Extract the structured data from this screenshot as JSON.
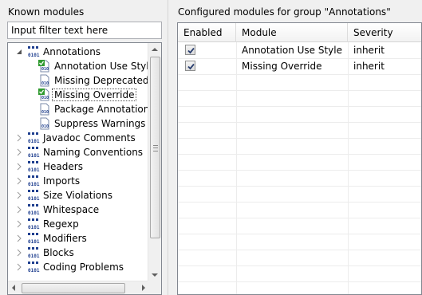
{
  "left": {
    "title": "Known modules",
    "filter_placeholder": "Input filter text here",
    "tree": [
      {
        "label": "Annotations",
        "level": 0,
        "expanded": true,
        "icon": "module-group-icon"
      },
      {
        "label": "Annotation Use Style",
        "level": 1,
        "icon": "module-checked-icon"
      },
      {
        "label": "Missing Deprecated",
        "level": 1,
        "icon": "module-icon"
      },
      {
        "label": "Missing Override",
        "level": 1,
        "icon": "module-checked-icon",
        "selected": true
      },
      {
        "label": "Package Annotation",
        "level": 1,
        "icon": "module-icon"
      },
      {
        "label": "Suppress Warnings",
        "level": 1,
        "icon": "module-icon"
      },
      {
        "label": "Javadoc Comments",
        "level": 0,
        "expanded": false,
        "icon": "module-group-icon"
      },
      {
        "label": "Naming Conventions",
        "level": 0,
        "expanded": false,
        "icon": "module-group-icon"
      },
      {
        "label": "Headers",
        "level": 0,
        "expanded": false,
        "icon": "module-group-icon"
      },
      {
        "label": "Imports",
        "level": 0,
        "expanded": false,
        "icon": "module-group-icon"
      },
      {
        "label": "Size Violations",
        "level": 0,
        "expanded": false,
        "icon": "module-group-icon"
      },
      {
        "label": "Whitespace",
        "level": 0,
        "expanded": false,
        "icon": "module-group-icon"
      },
      {
        "label": "Regexp",
        "level": 0,
        "expanded": false,
        "icon": "module-group-icon"
      },
      {
        "label": "Modifiers",
        "level": 0,
        "expanded": false,
        "icon": "module-group-icon"
      },
      {
        "label": "Blocks",
        "level": 0,
        "expanded": false,
        "icon": "module-group-icon"
      },
      {
        "label": "Coding Problems",
        "level": 0,
        "expanded": false,
        "icon": "module-group-icon"
      }
    ]
  },
  "right": {
    "title": "Configured modules for group \"Annotations\"",
    "columns": [
      "Enabled",
      "Module",
      "Severity"
    ],
    "rows": [
      {
        "enabled": true,
        "module": "Annotation Use Style",
        "severity": "inherit"
      },
      {
        "enabled": true,
        "module": "Missing Override",
        "severity": "inherit"
      }
    ]
  },
  "colors": {
    "icon_blue": "#1f3f8f",
    "icon_green": "#2f9a2f",
    "selection_border": "#555555"
  }
}
